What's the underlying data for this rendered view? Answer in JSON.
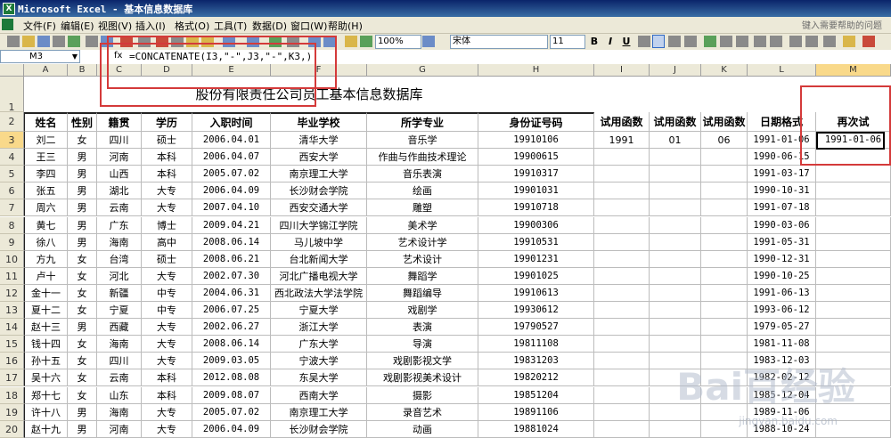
{
  "window": {
    "title": "Microsoft Excel - 基本信息数据库"
  },
  "menu": {
    "items": [
      "文件(F)",
      "编辑(E)",
      "视图(V)",
      "插入(I)",
      "格式(O)",
      "工具(T)",
      "数据(D)",
      "窗口(W)",
      "帮助(H)"
    ],
    "help_placeholder": "键入需要帮助的问题"
  },
  "toolbar": {
    "zoom": "100%",
    "font": "宋体",
    "size": "11",
    "bold": "B",
    "italic": "I",
    "underline": "U"
  },
  "formula_bar": {
    "name_box": "M3",
    "fx": "fx",
    "formula": "=CONCATENATE(I3,\"-\",J3,\"-\",K3,)"
  },
  "columns": [
    "A",
    "B",
    "C",
    "D",
    "E",
    "F",
    "G",
    "H",
    "I",
    "J",
    "K",
    "L",
    "M"
  ],
  "selected_column": "M",
  "selected_row": "3",
  "sheet": {
    "title": "股份有限责任公司员工基本信息数据库",
    "headers": [
      "姓名",
      "性别",
      "籍贯",
      "学历",
      "入职时间",
      "毕业学校",
      "所学专业",
      "身份证号码"
    ],
    "extra_headers": [
      "试用函数",
      "试用函数",
      "试用函数",
      "日期格式",
      "再次试"
    ],
    "rows": [
      {
        "r": "3",
        "c": [
          "刘二",
          "女",
          "四川",
          "硕士",
          "2006.04.01",
          "清华大学",
          "音乐学",
          "19910106"
        ],
        "x": [
          "1991",
          "01",
          "06",
          "1991-01-06",
          "1991-01-06"
        ]
      },
      {
        "r": "4",
        "c": [
          "王三",
          "男",
          "河南",
          "本科",
          "2006.04.07",
          "西安大学",
          "作曲与作曲技术理论",
          "19900615"
        ],
        "x": [
          "",
          "",
          "",
          "1990-06-15",
          ""
        ]
      },
      {
        "r": "5",
        "c": [
          "李四",
          "男",
          "山西",
          "本科",
          "2005.07.02",
          "南京理工大学",
          "音乐表演",
          "19910317"
        ],
        "x": [
          "",
          "",
          "",
          "1991-03-17",
          ""
        ]
      },
      {
        "r": "6",
        "c": [
          "张五",
          "男",
          "湖北",
          "大专",
          "2006.04.09",
          "长沙财会学院",
          "绘画",
          "19901031"
        ],
        "x": [
          "",
          "",
          "",
          "1990-10-31",
          ""
        ]
      },
      {
        "r": "7",
        "c": [
          "周六",
          "男",
          "云南",
          "大专",
          "2007.04.10",
          "西安交通大学",
          "雕塑",
          "19910718"
        ],
        "x": [
          "",
          "",
          "",
          "1991-07-18",
          ""
        ]
      },
      {
        "r": "8",
        "c": [
          "黄七",
          "男",
          "广东",
          "博士",
          "2009.04.21",
          "四川大学锦江学院",
          "美术学",
          "19900306"
        ],
        "x": [
          "",
          "",
          "",
          "1990-03-06",
          ""
        ]
      },
      {
        "r": "9",
        "c": [
          "徐八",
          "男",
          "海南",
          "高中",
          "2008.06.14",
          "马儿坡中学",
          "艺术设计学",
          "19910531"
        ],
        "x": [
          "",
          "",
          "",
          "1991-05-31",
          ""
        ]
      },
      {
        "r": "10",
        "c": [
          "方九",
          "女",
          "台湾",
          "硕士",
          "2008.06.21",
          "台北新闻大学",
          "艺术设计",
          "19901231"
        ],
        "x": [
          "",
          "",
          "",
          "1990-12-31",
          ""
        ]
      },
      {
        "r": "11",
        "c": [
          "卢十",
          "女",
          "河北",
          "大专",
          "2002.07.30",
          "河北广播电视大学",
          "舞蹈学",
          "19901025"
        ],
        "x": [
          "",
          "",
          "",
          "1990-10-25",
          ""
        ]
      },
      {
        "r": "12",
        "c": [
          "金十一",
          "女",
          "新疆",
          "中专",
          "2004.06.31",
          "西北政法大学法学院",
          "舞蹈编导",
          "19910613"
        ],
        "x": [
          "",
          "",
          "",
          "1991-06-13",
          ""
        ]
      },
      {
        "r": "13",
        "c": [
          "夏十二",
          "女",
          "宁夏",
          "中专",
          "2006.07.25",
          "宁夏大学",
          "戏剧学",
          "19930612"
        ],
        "x": [
          "",
          "",
          "",
          "1993-06-12",
          ""
        ]
      },
      {
        "r": "14",
        "c": [
          "赵十三",
          "男",
          "西藏",
          "大专",
          "2002.06.27",
          "浙江大学",
          "表演",
          "19790527"
        ],
        "x": [
          "",
          "",
          "",
          "1979-05-27",
          ""
        ]
      },
      {
        "r": "15",
        "c": [
          "钱十四",
          "女",
          "海南",
          "大专",
          "2008.06.14",
          "广东大学",
          "导演",
          "19811108"
        ],
        "x": [
          "",
          "",
          "",
          "1981-11-08",
          ""
        ]
      },
      {
        "r": "16",
        "c": [
          "孙十五",
          "女",
          "四川",
          "大专",
          "2009.03.05",
          "宁波大学",
          "戏剧影视文学",
          "19831203"
        ],
        "x": [
          "",
          "",
          "",
          "1983-12-03",
          ""
        ]
      },
      {
        "r": "17",
        "c": [
          "吴十六",
          "女",
          "云南",
          "本科",
          "2012.08.08",
          "东吴大学",
          "戏剧影视美术设计",
          "19820212"
        ],
        "x": [
          "",
          "",
          "",
          "1982-02-12",
          ""
        ]
      },
      {
        "r": "18",
        "c": [
          "郑十七",
          "女",
          "山东",
          "本科",
          "2009.08.07",
          "西南大学",
          "摄影",
          "19851204"
        ],
        "x": [
          "",
          "",
          "",
          "1985-12-04",
          ""
        ]
      },
      {
        "r": "19",
        "c": [
          "许十八",
          "男",
          "海南",
          "大专",
          "2005.07.02",
          "南京理工大学",
          "录音艺术",
          "19891106"
        ],
        "x": [
          "",
          "",
          "",
          "1989-11-06",
          ""
        ]
      },
      {
        "r": "20",
        "c": [
          "赵十九",
          "男",
          "河南",
          "大专",
          "2006.04.09",
          "长沙财会学院",
          "动画",
          "19881024"
        ],
        "x": [
          "",
          "",
          "",
          "1988-10-24",
          ""
        ]
      }
    ]
  },
  "watermark": {
    "text": "Bai百经验",
    "sub": "jingyan.baidu.com"
  },
  "colors": {
    "accent_red": "#d43a3a",
    "header_gray": "#ece9d8",
    "selected_header": "#f9d98a"
  }
}
